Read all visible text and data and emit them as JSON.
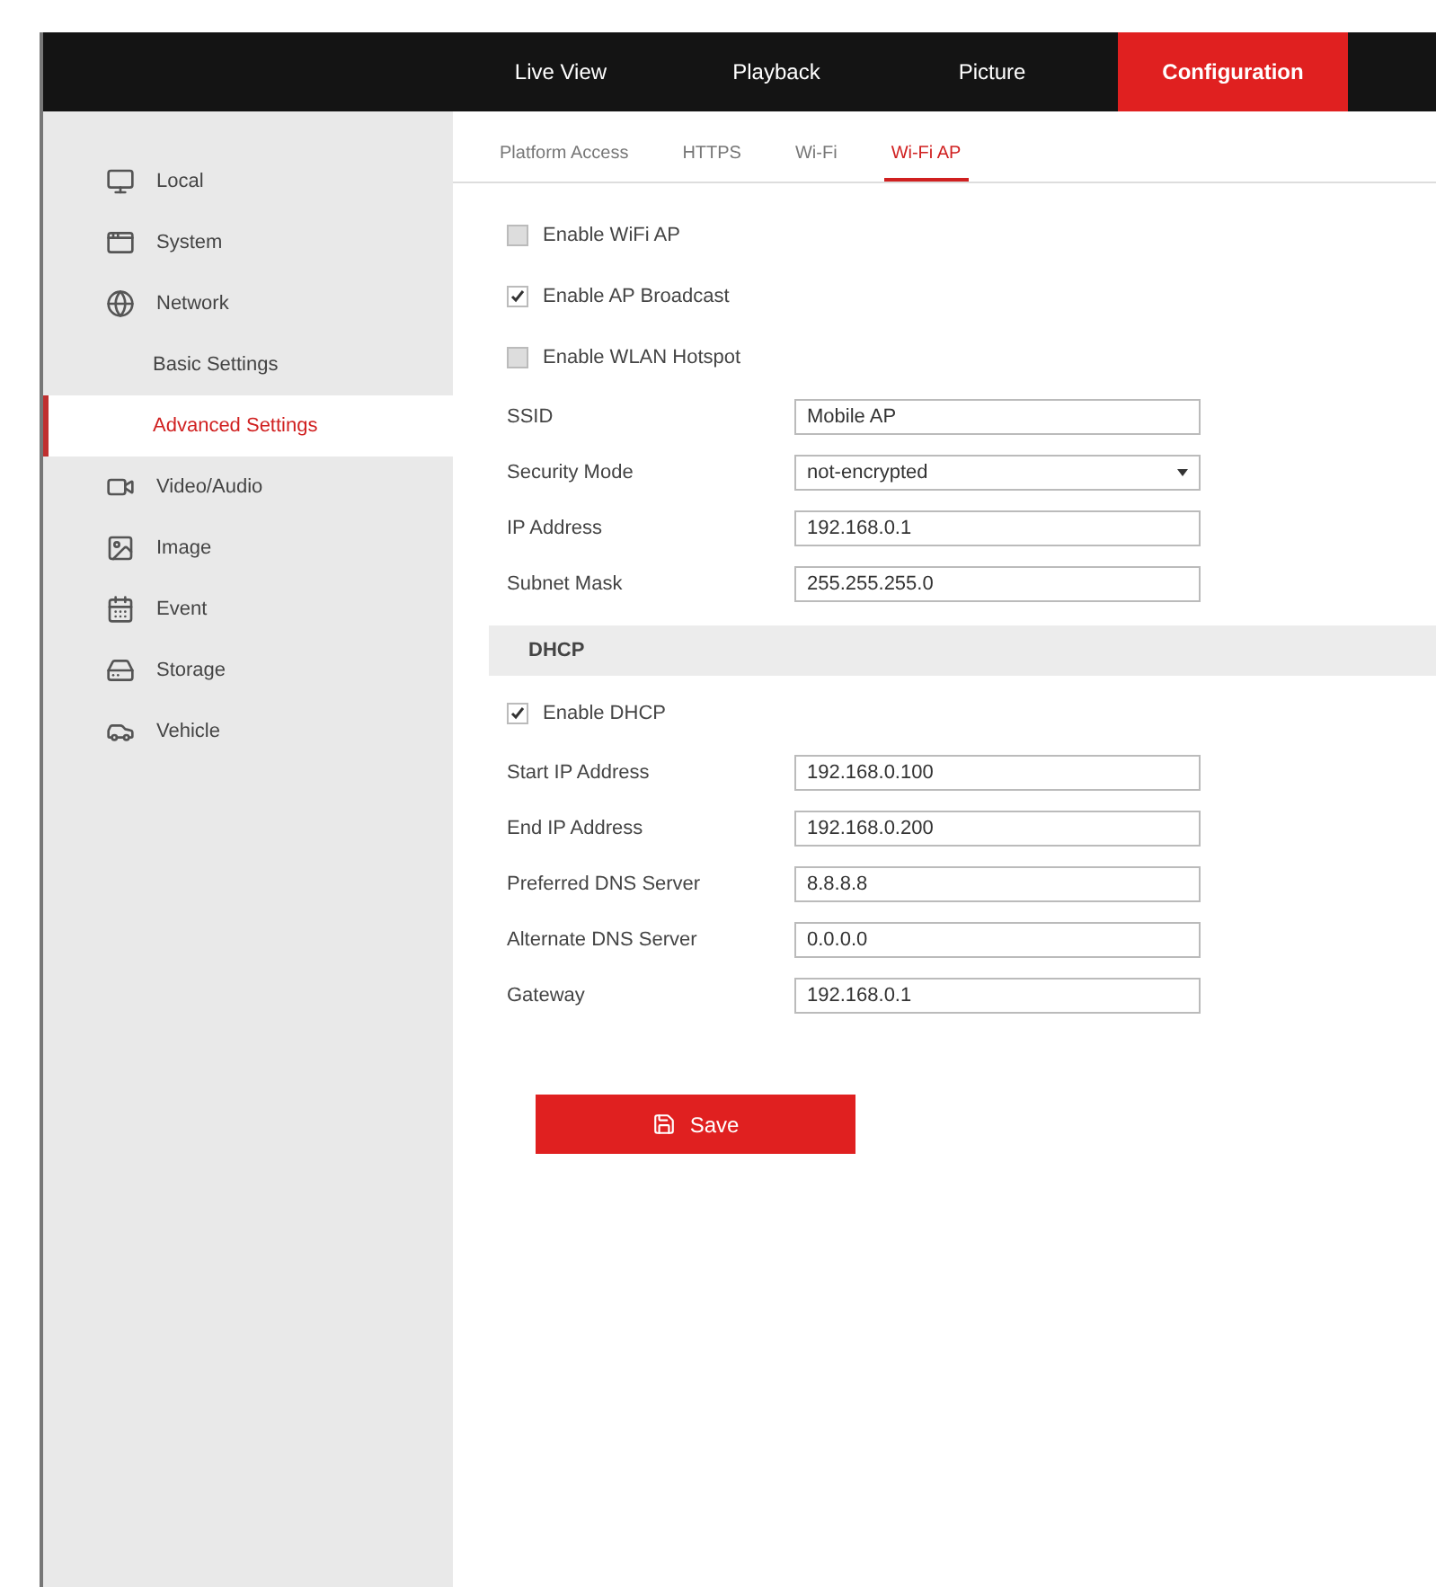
{
  "top_nav": [
    {
      "label": "Live View",
      "selected": false
    },
    {
      "label": "Playback",
      "selected": false
    },
    {
      "label": "Picture",
      "selected": false
    },
    {
      "label": "Configuration",
      "selected": true
    }
  ],
  "sidebar": {
    "items": [
      {
        "label": "Local",
        "selected": false
      },
      {
        "label": "System",
        "selected": false
      },
      {
        "label": "Network",
        "selected": false,
        "children": [
          {
            "label": "Basic Settings",
            "selected": false
          },
          {
            "label": "Advanced Settings",
            "selected": true
          }
        ]
      },
      {
        "label": "Video/Audio",
        "selected": false
      },
      {
        "label": "Image",
        "selected": false
      },
      {
        "label": "Event",
        "selected": false
      },
      {
        "label": "Storage",
        "selected": false
      },
      {
        "label": "Vehicle",
        "selected": false
      }
    ]
  },
  "sub_tabs": [
    {
      "label": "Platform Access",
      "selected": false
    },
    {
      "label": "HTTPS",
      "selected": false
    },
    {
      "label": "Wi-Fi",
      "selected": false
    },
    {
      "label": "Wi-Fi AP",
      "selected": true
    }
  ],
  "form": [
    {
      "kind": "checkbox",
      "label": "Enable WiFi AP",
      "checked": false
    },
    {
      "kind": "checkbox",
      "label": "Enable AP Broadcast",
      "checked": true
    },
    {
      "kind": "checkbox",
      "label": "Enable WLAN Hotspot",
      "checked": false
    },
    {
      "kind": "text",
      "label": "SSID",
      "value": "Mobile AP"
    },
    {
      "kind": "select",
      "label": "Security Mode",
      "value": "not-encrypted"
    },
    {
      "kind": "text",
      "label": "IP Address",
      "value": "192.168.0.1"
    },
    {
      "kind": "text",
      "label": "Subnet Mask",
      "value": "255.255.255.0"
    },
    {
      "kind": "header",
      "label": "DHCP"
    },
    {
      "kind": "checkbox",
      "label": "Enable DHCP",
      "checked": true
    },
    {
      "kind": "text",
      "label": "Start IP Address",
      "value": "192.168.0.100"
    },
    {
      "kind": "text",
      "label": "End IP Address",
      "value": "192.168.0.200"
    },
    {
      "kind": "text",
      "label": "Preferred DNS Server",
      "value": "8.8.8.8"
    },
    {
      "kind": "text",
      "label": "Alternate DNS Server",
      "value": "0.0.0.0"
    },
    {
      "kind": "text",
      "label": "Gateway",
      "value": "192.168.0.1"
    }
  ],
  "save_button": {
    "label": "Save"
  }
}
